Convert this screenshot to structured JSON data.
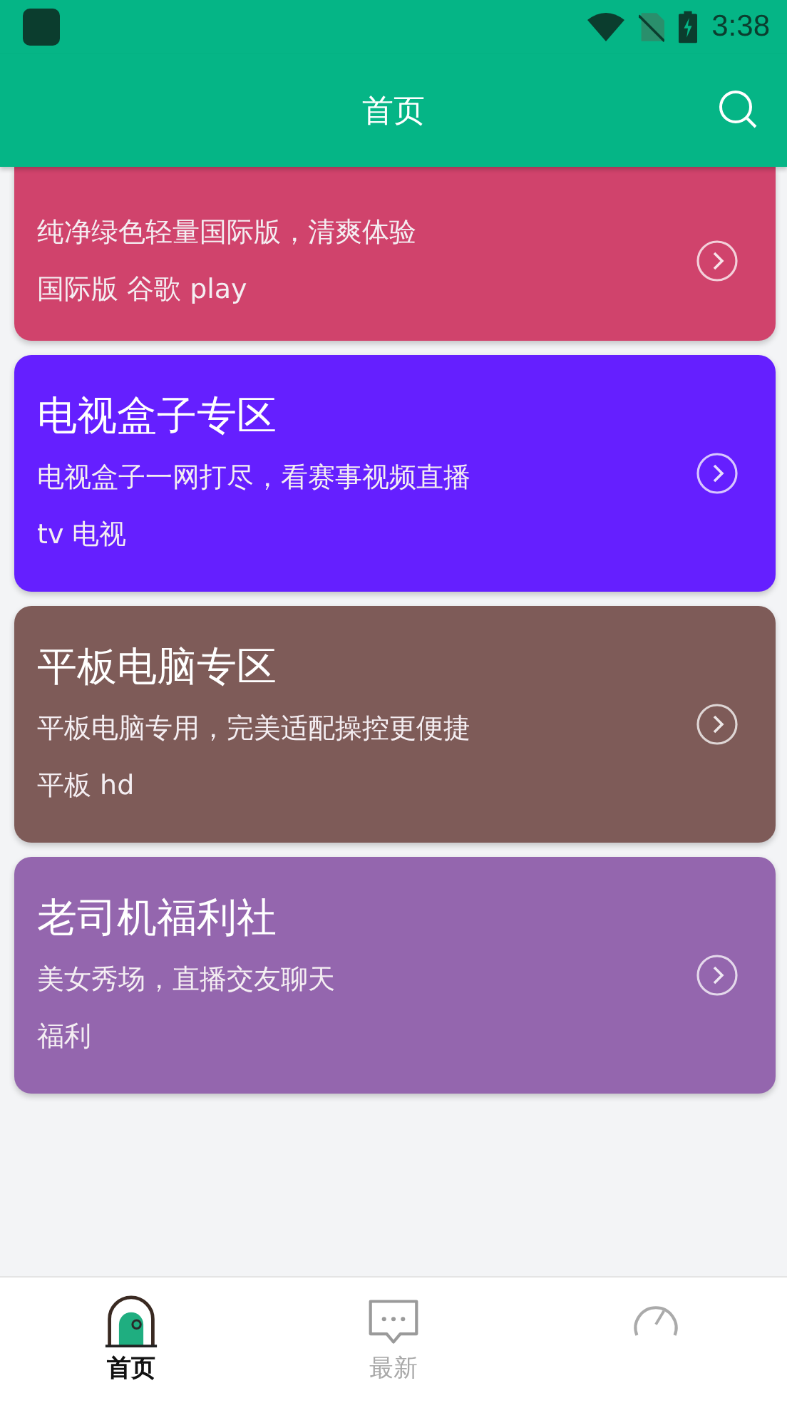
{
  "status_bar": {
    "time": "3:38"
  },
  "app_bar": {
    "title": "首页"
  },
  "cards": [
    {
      "description": "纯净绿色轻量国际版，清爽体验",
      "tags": "国际版 谷歌 play",
      "color": "#d0436c"
    },
    {
      "title": "电视盒子专区",
      "description": "电视盒子一网打尽，看赛事视频直播",
      "tags": "tv 电视",
      "color": "#651fff"
    },
    {
      "title": "平板电脑专区",
      "description": "平板电脑专用，完美适配操控更便捷",
      "tags": "平板 hd",
      "color": "#7e5b58"
    },
    {
      "title": "老司机福利社",
      "description": "美女秀场，直播交友聊天",
      "tags": "福利",
      "color": "#9466ae"
    }
  ],
  "bottom_nav": [
    {
      "kind": "home",
      "label": "首页",
      "selected": true
    },
    {
      "kind": "chat",
      "label": "最新",
      "selected": false
    },
    {
      "kind": "gauge",
      "selected": false
    }
  ]
}
